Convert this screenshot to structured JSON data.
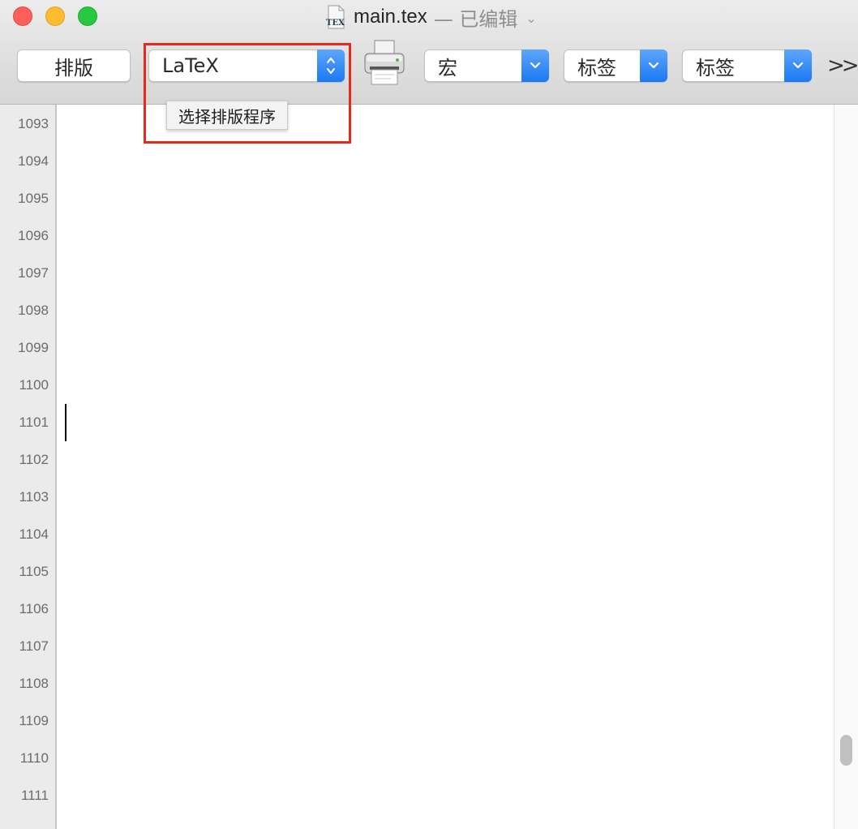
{
  "window": {
    "file_name": "main.tex",
    "edit_state": "— 已编辑",
    "title_menu_glyph": "⌄"
  },
  "toolbar": {
    "typeset_label": "排版",
    "engine_value": "LaTeX",
    "engine_tooltip": "选择排版程序",
    "print_icon": "printer-icon",
    "macro_label": "宏",
    "tag_label_1": "标签",
    "tag_label_2": "标签",
    "overflow_label": ">>"
  },
  "editor": {
    "line_numbers": [
      "1093",
      "1094",
      "1095",
      "1096",
      "1097",
      "1098",
      "1099",
      "1100",
      "1101",
      "1102",
      "1103",
      "1104",
      "1105",
      "1106",
      "1107",
      "1108",
      "1109",
      "1110",
      "1111"
    ],
    "caret_line": "1101"
  },
  "colors": {
    "close": "#fc5f57",
    "minimize": "#fdbc2e",
    "zoom": "#28c840",
    "accent": "#1c78f0",
    "highlight": "#e52a1b"
  }
}
